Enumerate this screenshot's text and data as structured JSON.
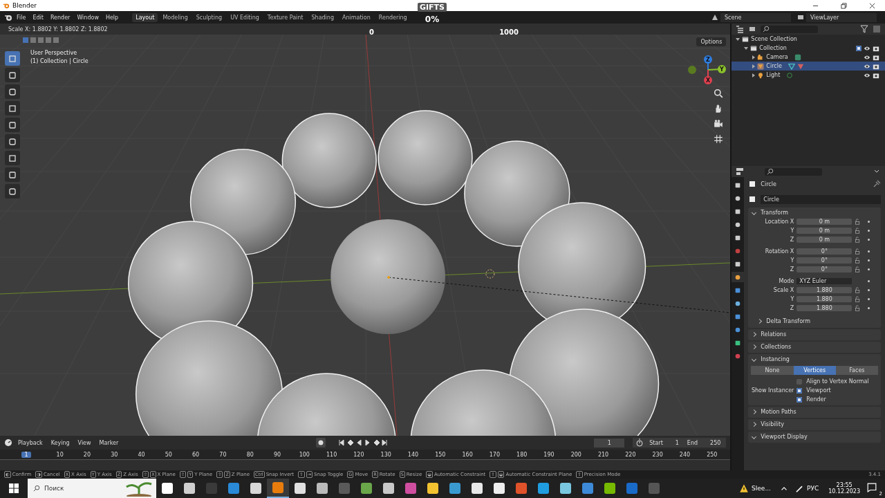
{
  "window": {
    "title": "Blender"
  },
  "menu": [
    "File",
    "Edit",
    "Render",
    "Window",
    "Help"
  ],
  "workspaces": [
    {
      "label": "Layout",
      "selected": true
    },
    {
      "label": "Modeling",
      "selected": false
    },
    {
      "label": "Sculpting",
      "selected": false
    },
    {
      "label": "UV Editing",
      "selected": false
    },
    {
      "label": "Texture Paint",
      "selected": false
    },
    {
      "label": "Shading",
      "selected": false
    },
    {
      "label": "Animation",
      "selected": false
    },
    {
      "label": "Rendering",
      "selected": false
    }
  ],
  "scene": "Scene",
  "view_layer": "ViewLayer",
  "stream_overlay": {
    "title": "GIFTS",
    "percent": "0%",
    "min": "0",
    "max": "1000"
  },
  "viewport": {
    "header": "Scale X: 1.8802   Y: 1.8802   Z: 1.8802",
    "perspective": "User Perspective",
    "context": "(1) Collection | Circle",
    "options": "Options",
    "tools": [
      {
        "selected": true
      },
      {
        "selected": false
      },
      {
        "selected": false
      },
      {
        "selected": false
      },
      {
        "selected": false
      },
      {
        "selected": false
      },
      {
        "selected": false
      },
      {
        "selected": false
      },
      {
        "selected": false
      }
    ],
    "gizmo": [
      {
        "label": "Z",
        "color": "#2f7de0"
      },
      {
        "label": "Y",
        "color": "#8bc22a"
      },
      {
        "label": "X",
        "color": "#e0404f"
      }
    ]
  },
  "outliner": {
    "items": [
      {
        "label": "Scene Collection",
        "kind": "collection",
        "children": [
          {
            "label": "Collection",
            "kind": "collection",
            "checked": true,
            "children": [
              {
                "label": "Camera",
                "kind": "camera",
                "selected": false
              },
              {
                "label": "Circle",
                "kind": "mesh",
                "selected": true
              },
              {
                "label": "Light",
                "kind": "light",
                "selected": false
              }
            ]
          }
        ]
      }
    ]
  },
  "properties": {
    "tabs": [
      {
        "selected": false
      },
      {
        "selected": false
      },
      {
        "selected": false
      },
      {
        "selected": false
      },
      {
        "selected": false
      },
      {
        "selected": false
      },
      {
        "selected": false
      },
      {
        "selected": true
      },
      {
        "selected": false
      },
      {
        "selected": false
      },
      {
        "selected": false
      },
      {
        "selected": false
      },
      {
        "selected": false
      },
      {
        "selected": false
      }
    ],
    "object_name": "Circle",
    "data_name": "Circle",
    "transform": {
      "title": "Transform",
      "groups": [
        [
          {
            "label": "Location X",
            "value": "0 m",
            "kind": "number"
          },
          {
            "label": "Y",
            "value": "0 m",
            "kind": "number"
          },
          {
            "label": "Z",
            "value": "0 m",
            "kind": "number"
          }
        ],
        [
          {
            "label": "Rotation X",
            "value": "0°",
            "kind": "number"
          },
          {
            "label": "Y",
            "value": "0°",
            "kind": "number"
          },
          {
            "label": "Z",
            "value": "0°",
            "kind": "number"
          }
        ],
        [
          {
            "label": "Mode",
            "value": "XYZ Euler",
            "kind": "dropdown"
          },
          {
            "label": "Scale X",
            "value": "1.880",
            "kind": "number"
          },
          {
            "label": "Y",
            "value": "1.880",
            "kind": "number"
          },
          {
            "label": "Z",
            "value": "1.880",
            "kind": "number"
          }
        ]
      ],
      "subpanel": "Delta Transform"
    },
    "panels": [
      {
        "title": "Relations",
        "expanded": false
      },
      {
        "title": "Collections",
        "expanded": false
      },
      {
        "title": "Instancing",
        "expanded": true,
        "options": [
          {
            "label": "None",
            "selected": false
          },
          {
            "label": "Vertices",
            "selected": true
          },
          {
            "label": "Faces",
            "selected": false
          }
        ],
        "align": {
          "label": "Align to Vertex Normal",
          "checked": false
        },
        "show_instancer": "Show Instancer",
        "checks": [
          {
            "label": "Viewport",
            "checked": true
          },
          {
            "label": "Render",
            "checked": true
          }
        ]
      },
      {
        "title": "Motion Paths",
        "expanded": false
      },
      {
        "title": "Visibility",
        "expanded": false
      },
      {
        "title": "Viewport Display",
        "expanded": true
      }
    ]
  },
  "timeline": {
    "menus": [
      "Playback",
      "Keying",
      "View",
      "Marker"
    ],
    "current": "1",
    "playhead": "1",
    "start_label": "Start",
    "start": "1",
    "end_label": "End",
    "end": "250",
    "ticks": [
      "10",
      "20",
      "30",
      "40",
      "50",
      "60",
      "70",
      "80",
      "90",
      "100",
      "110",
      "120",
      "130",
      "140",
      "150",
      "160",
      "170",
      "180",
      "190",
      "200",
      "210",
      "220",
      "230",
      "240",
      "250"
    ]
  },
  "status": {
    "items": [
      {
        "keys": [
          "◐"
        ],
        "label": "Confirm"
      },
      {
        "keys": [
          "◑"
        ],
        "label": "Cancel"
      },
      {
        "keys": [
          "X"
        ],
        "label": "X Axis"
      },
      {
        "keys": [
          "Y"
        ],
        "label": "Y Axis"
      },
      {
        "keys": [
          "Z"
        ],
        "label": "Z Axis"
      },
      {
        "keys": [
          "⇧",
          "X"
        ],
        "label": "X Plane"
      },
      {
        "keys": [
          "⇧",
          "Y"
        ],
        "label": "Y Plane"
      },
      {
        "keys": [
          "⇧",
          "Z"
        ],
        "label": "Z Plane"
      },
      {
        "keys": [
          "Ctrl"
        ],
        "label": "Snap Invert"
      },
      {
        "keys": [
          "⇧",
          "⇥"
        ],
        "label": "Snap Toggle"
      },
      {
        "keys": [
          "G"
        ],
        "label": "Move"
      },
      {
        "keys": [
          "R"
        ],
        "label": "Rotate"
      },
      {
        "keys": [
          "S"
        ],
        "label": "Resize"
      },
      {
        "keys": [
          "◒"
        ],
        "label": "Automatic Constraint"
      },
      {
        "keys": [
          "⇧",
          "◒"
        ],
        "label": "Automatic Constraint Plane"
      },
      {
        "keys": [
          "⇧"
        ],
        "label": "Precision Mode"
      }
    ],
    "version": "3.4.1"
  },
  "taskbar": {
    "search": "Поиск",
    "apps": [
      {
        "color": "#ffffff",
        "selected": false
      },
      {
        "color": "#cfcfcf",
        "selected": false
      },
      {
        "color": "#3a3a3a",
        "selected": false
      },
      {
        "color": "#2a8ad8",
        "selected": false
      },
      {
        "color": "#d8d8d8",
        "selected": false
      },
      {
        "color": "#e87d0d",
        "selected": true
      },
      {
        "color": "#e0e0e0",
        "selected": false
      },
      {
        "color": "#bbbbbb",
        "selected": false
      },
      {
        "color": "#5a5a5a",
        "selected": false
      },
      {
        "color": "#6aa64a",
        "selected": false
      },
      {
        "color": "#c8c8c8",
        "selected": false
      },
      {
        "color": "#d04ea0",
        "selected": false
      },
      {
        "color": "#f2c230",
        "selected": false
      },
      {
        "color": "#3a9ad0",
        "selected": false
      },
      {
        "color": "#e8e8e8",
        "selected": false
      },
      {
        "color": "#eeeeee",
        "selected": false
      },
      {
        "color": "#e0522a",
        "selected": false
      },
      {
        "color": "#1f9de0",
        "selected": false
      },
      {
        "color": "#7ac8e0",
        "selected": false
      },
      {
        "color": "#3c8ad8",
        "selected": false
      },
      {
        "color": "#76b900",
        "selected": false
      },
      {
        "color": "#1a6ac8",
        "selected": false
      },
      {
        "color": "#555555",
        "selected": false
      }
    ],
    "notification": "Slee...",
    "language": "РУС",
    "time": "23:55",
    "date": "10.12.2023",
    "badge": "2"
  }
}
